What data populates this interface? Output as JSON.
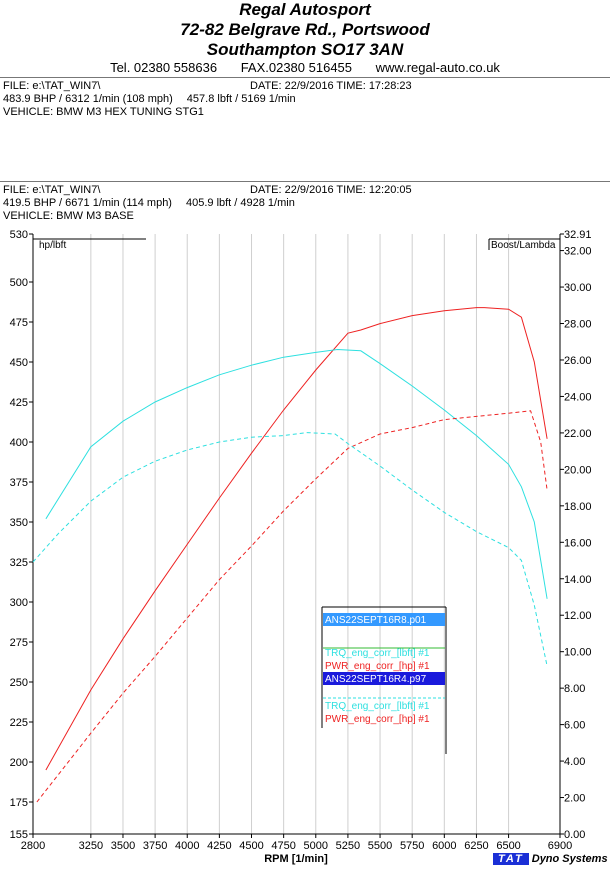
{
  "header": {
    "company": "Regal Autosport",
    "address1": "72-82 Belgrave Rd., Portswood",
    "address2": "Southampton SO17 3AN",
    "tel": "Tel. 02380 558636",
    "fax": "FAX.02380 516455",
    "web": "www.regal-auto.co.uk"
  },
  "run1": {
    "file": "FILE: e:\\TAT_WIN7\\",
    "date": "DATE: 22/9/2016  TIME: 17:28:23",
    "power": "483.9 BHP / 6312 1/min (108 mph)",
    "torque": "457.8 lbft / 5169 1/min",
    "vehicle": "VEHICLE: BMW M3 HEX TUNING STG1"
  },
  "run2": {
    "file": "FILE: e:\\TAT_WIN7\\",
    "date": "DATE: 22/9/2016  TIME: 12:20:05",
    "power": "419.5 BHP / 6671 1/min (114 mph)",
    "torque": "405.9 lbft / 4928 1/min",
    "vehicle": "VEHICLE: BMW M3 BASE"
  },
  "brand": {
    "tat": "TAT",
    "name": "Dyno Systems"
  },
  "chart_data": {
    "type": "line",
    "xlabel": "RPM  [1/min]",
    "ylabel_left": "hp/lbft",
    "ylabel_right": "Boost/Lambda",
    "xlim": [
      2800,
      6900
    ],
    "ylim_left": [
      155,
      530
    ],
    "ylim_right": [
      0,
      32.91
    ],
    "x_ticks": [
      2800,
      3250,
      3500,
      3750,
      4000,
      4250,
      4500,
      4750,
      5000,
      5250,
      5500,
      5750,
      6000,
      6250,
      6500,
      6900
    ],
    "y_left_ticks": [
      155,
      175,
      200,
      225,
      250,
      275,
      300,
      325,
      350,
      375,
      400,
      425,
      450,
      475,
      500,
      530
    ],
    "y_right_ticks": [
      "0.00",
      "2.00",
      "4.00",
      "6.00",
      "8.00",
      "10.00",
      "12.00",
      "14.00",
      "16.00",
      "18.00",
      "20.00",
      "22.00",
      "24.00",
      "26.00",
      "28.00",
      "30.00",
      "32.00",
      "32.91"
    ],
    "grid_x": [
      3250,
      3500,
      3750,
      4000,
      4250,
      4500,
      4750,
      5000,
      5250,
      5500,
      5750,
      6000,
      6250,
      6500
    ],
    "legend_position": "center-right",
    "legend": {
      "groups": [
        {
          "file": "ANS22SEPT16R8.p01",
          "file_color": "#3399ff",
          "entries": [
            {
              "label": "TRQ_eng_corr_[lbft] #1",
              "color": "#2ee0e0"
            },
            {
              "label": "PWR_eng_corr_[hp] #1",
              "color": "#ee2222"
            }
          ]
        },
        {
          "file": "ANS22SEPT16R4.p97",
          "file_color": "#1a1adc",
          "entries": [
            {
              "label": "TRQ_eng_corr_[lbft] #1",
              "color": "#2ee0e0"
            },
            {
              "label": "PWR_eng_corr_[hp] #1",
              "color": "#ee2222"
            }
          ]
        }
      ]
    },
    "series": [
      {
        "name": "PWR_eng_corr_[hp] #1",
        "run": "ANS22SEPT16R8.p01",
        "color": "#ee2222",
        "dash": false,
        "x": [
          2900,
          3250,
          3500,
          3750,
          4000,
          4250,
          4500,
          4750,
          5000,
          5250,
          5350,
          5500,
          5750,
          6000,
          6250,
          6312,
          6500,
          6600,
          6700,
          6800
        ],
        "y": [
          195,
          245,
          277,
          307,
          336,
          365,
          393,
          420,
          445,
          468,
          470,
          474,
          479,
          482,
          484,
          484,
          483,
          478,
          450,
          402
        ]
      },
      {
        "name": "TRQ_eng_corr_[lbft] #1",
        "run": "ANS22SEPT16R8.p01",
        "color": "#2ee0e0",
        "dash": false,
        "x": [
          2900,
          3250,
          3500,
          3750,
          4000,
          4250,
          4500,
          4750,
          5000,
          5169,
          5350,
          5500,
          5750,
          6000,
          6250,
          6500,
          6600,
          6700,
          6800
        ],
        "y": [
          352,
          397,
          413,
          425,
          434,
          442,
          448,
          453,
          456,
          457.8,
          457,
          449,
          435,
          420,
          404,
          386,
          372,
          350,
          302
        ]
      },
      {
        "name": "PWR_eng_corr_[hp] #1",
        "run": "ANS22SEPT16R4.p97",
        "color": "#ee2222",
        "dash": true,
        "x": [
          2830,
          3250,
          3500,
          3750,
          4000,
          4250,
          4500,
          4750,
          5000,
          5250,
          5500,
          5750,
          6000,
          6250,
          6500,
          6671,
          6750,
          6800
        ],
        "y": [
          175,
          218,
          243,
          266,
          290,
          314,
          335,
          357,
          377,
          396,
          405,
          409,
          414,
          416,
          418,
          419.5,
          400,
          370
        ]
      },
      {
        "name": "TRQ_eng_corr_[lbft] #1",
        "run": "ANS22SEPT16R4.p97",
        "color": "#2ee0e0",
        "dash": true,
        "x": [
          2800,
          3000,
          3250,
          3500,
          3750,
          4000,
          4250,
          4500,
          4750,
          4928,
          5150,
          5250,
          5500,
          5750,
          6000,
          6250,
          6500,
          6600,
          6700,
          6800
        ],
        "y": [
          325,
          343,
          363,
          378,
          388,
          395,
          400,
          403,
          404,
          405.9,
          405,
          399,
          385,
          370,
          356,
          344,
          334,
          326,
          298,
          260
        ]
      }
    ]
  }
}
